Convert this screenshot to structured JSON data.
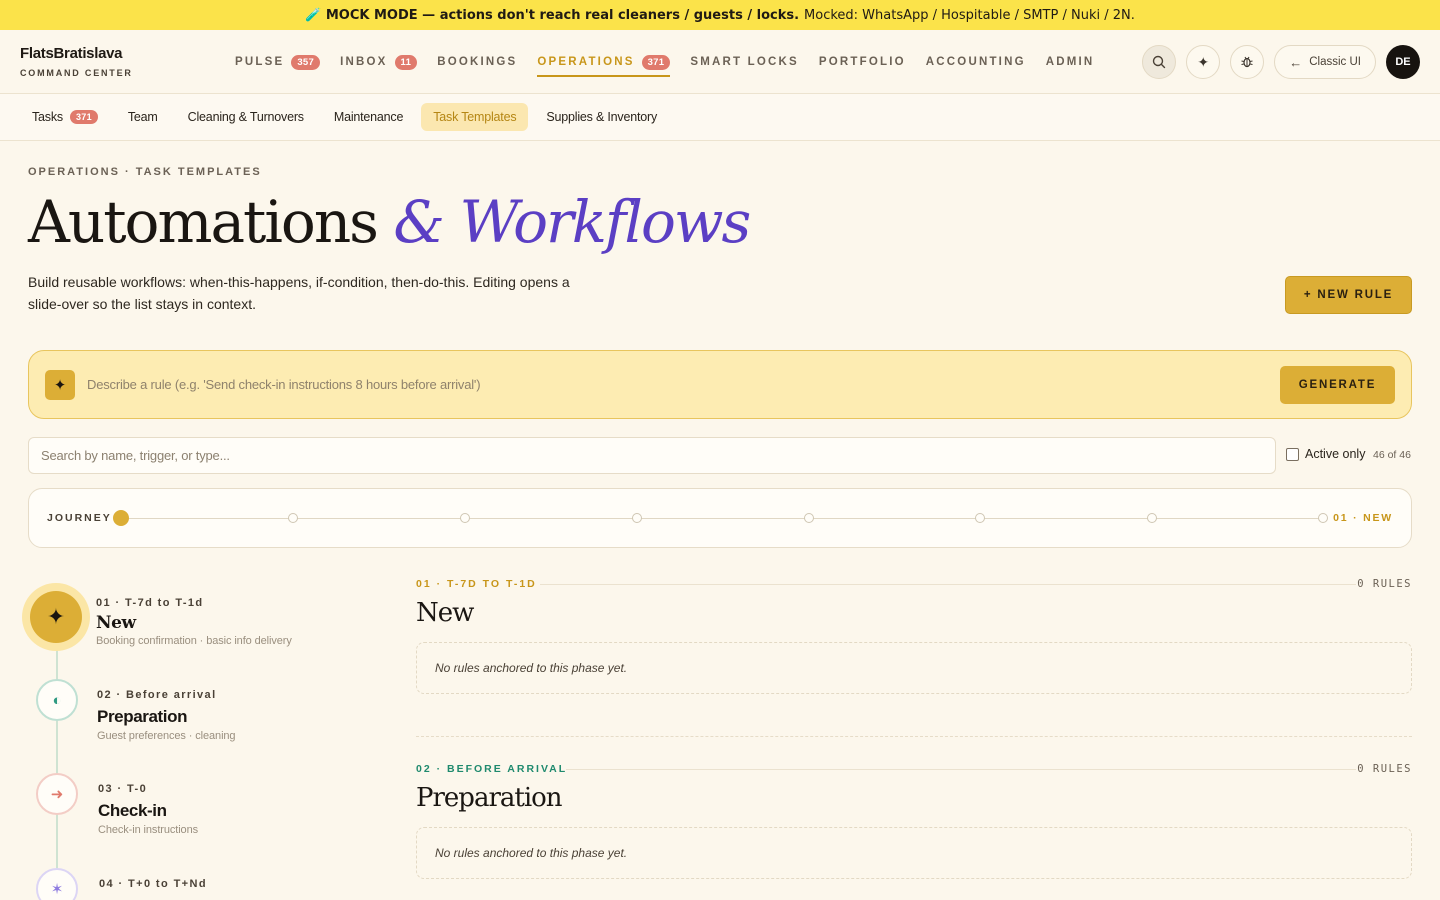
{
  "banner": {
    "bold": "🧪 MOCK MODE — actions don't reach real cleaners / guests / locks.",
    "rest": "Mocked: WhatsApp / Hospitable / SMTP / Nuki / 2N."
  },
  "brand": {
    "name": "FlatsBratislava",
    "sub": "COMMAND CENTER"
  },
  "nav": {
    "items": [
      {
        "label": "PULSE",
        "badge": "357"
      },
      {
        "label": "INBOX",
        "badge": "11"
      },
      {
        "label": "BOOKINGS",
        "badge": ""
      },
      {
        "label": "OPERATIONS",
        "badge": "371"
      },
      {
        "label": "SMART LOCKS",
        "badge": ""
      },
      {
        "label": "PORTFOLIO",
        "badge": ""
      },
      {
        "label": "ACCOUNTING",
        "badge": ""
      },
      {
        "label": "ADMIN",
        "badge": ""
      }
    ],
    "active": "OPERATIONS",
    "classic_label": "Classic UI",
    "avatar": "DE",
    "icons": [
      "search-icon",
      "sparkle-icon",
      "bug-icon",
      "arrow-left-icon"
    ]
  },
  "subnav": {
    "items": [
      {
        "label": "Tasks",
        "badge": "371"
      },
      {
        "label": "Team",
        "badge": ""
      },
      {
        "label": "Cleaning & Turnovers",
        "badge": ""
      },
      {
        "label": "Maintenance",
        "badge": ""
      },
      {
        "label": "Task Templates",
        "badge": ""
      },
      {
        "label": "Supplies & Inventory",
        "badge": ""
      }
    ],
    "active": "Task Templates"
  },
  "page": {
    "eyebrow": "OPERATIONS · TASK TEMPLATES",
    "title_main": "Automations",
    "title_accent": "& Workflows",
    "description": "Build reusable workflows: when-this-happens, if-condition, then-do-this. Editing opens a slide-over so the list stays in context.",
    "new_rule": "+ NEW RULE"
  },
  "generator": {
    "placeholder": "Describe a rule (e.g. 'Send check-in instructions 8 hours before arrival')",
    "button": "GENERATE"
  },
  "filter": {
    "search_placeholder": "Search by name, trigger, or type...",
    "active_only": "Active only",
    "count": "46 of 46"
  },
  "journey": {
    "label": "JOURNEY",
    "current": "01 · NEW",
    "steps": 8,
    "active_index": 0
  },
  "phases": [
    {
      "meta": "01 · T-7d to T-1d",
      "title": "New",
      "subtitle": "Booking confirmation · basic info delivery",
      "icon": "sparkle-icon"
    },
    {
      "meta": "02 · Before arrival",
      "title": "Preparation",
      "subtitle": "Guest preferences · cleaning",
      "icon": "half-moon-icon"
    },
    {
      "meta": "03 · T-0",
      "title": "Check-in",
      "subtitle": "Check-in instructions",
      "icon": "arrow-right-icon"
    },
    {
      "meta": "04 · T+0 to T+Nd",
      "title": "",
      "subtitle": "",
      "icon": "asterisk-icon"
    }
  ],
  "sections": [
    {
      "meta": "01 · T-7D TO T-1D",
      "rules": "0 RULES",
      "title": "New",
      "empty": "No rules anchored to this phase yet."
    },
    {
      "meta": "02 · BEFORE ARRIVAL",
      "rules": "0 RULES",
      "title": "Preparation",
      "empty": "No rules anchored to this phase yet."
    }
  ],
  "colors": {
    "banner": "#fbe34a",
    "accent_gold": "#dcae36",
    "accent_purple": "#5b3fc4",
    "badge_red": "#e07a6c",
    "phase2_teal": "#2f9a82",
    "phase3_red": "#e07a6c",
    "phase4_purple": "#8e7be0"
  }
}
